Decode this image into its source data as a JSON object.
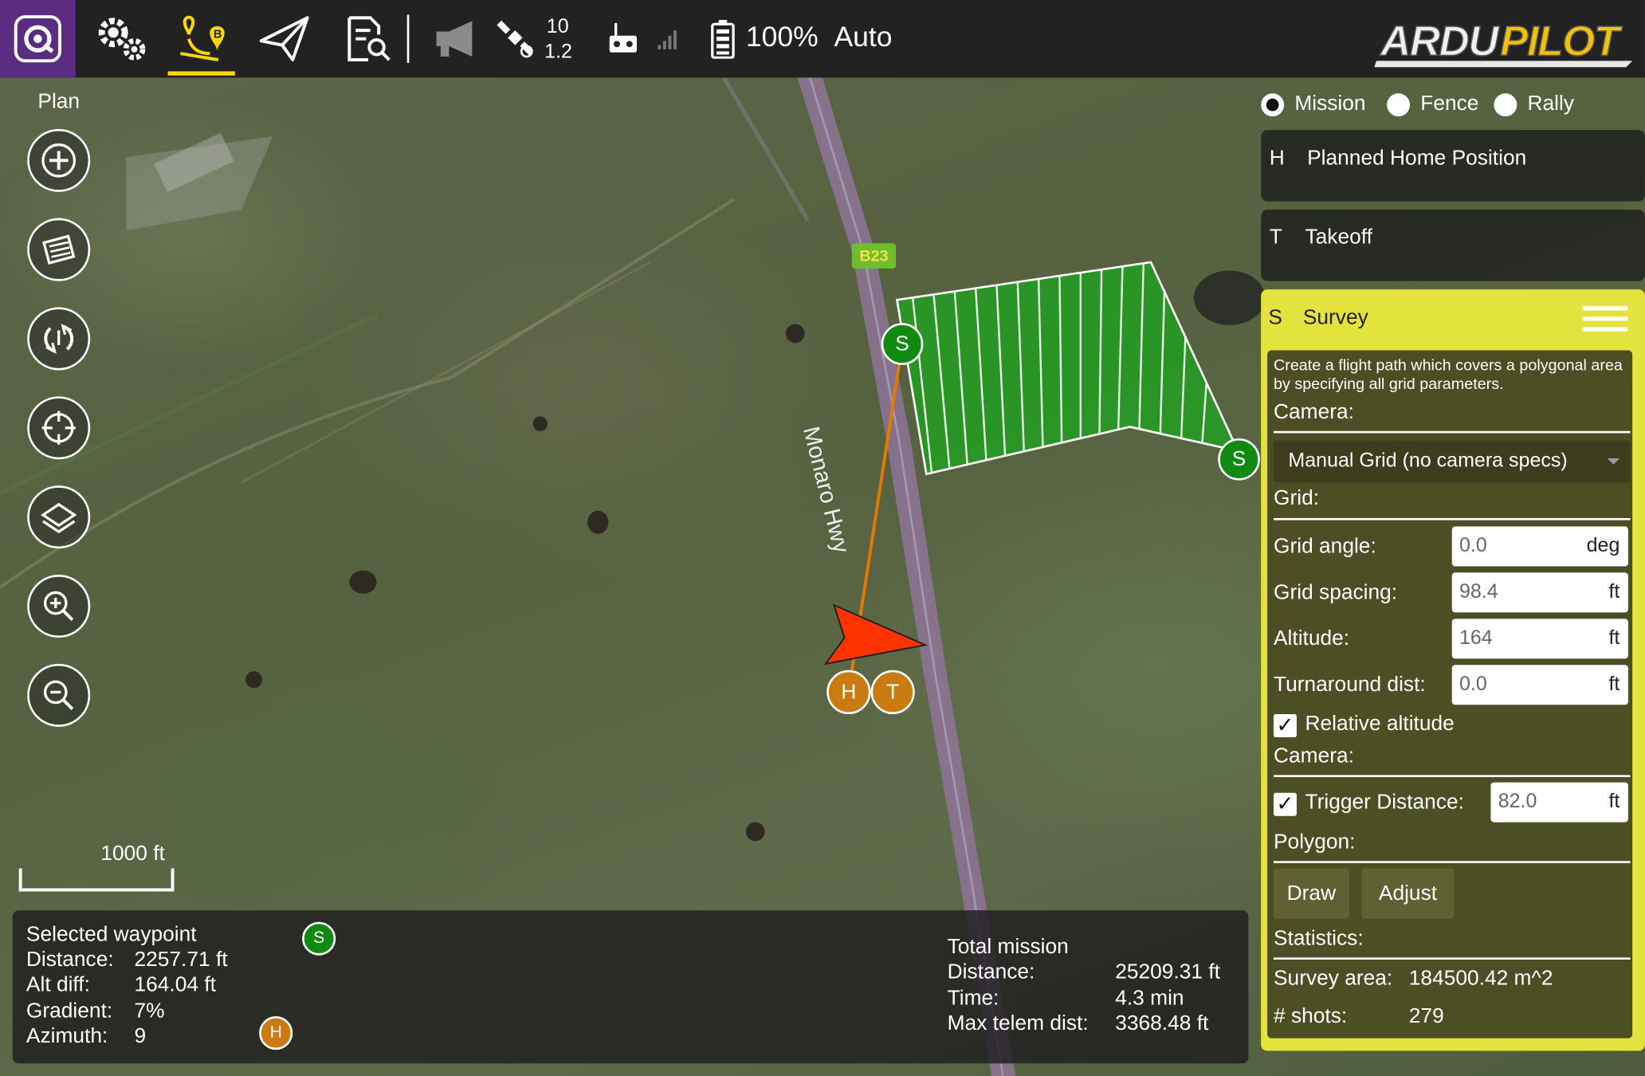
{
  "app": {
    "logo_icon": "qgc-logo-icon"
  },
  "toolbar": {
    "satellite_count": "10",
    "hdop": "1.2",
    "battery": "100%",
    "flight_mode": "Auto",
    "brand": "ARDUPILOT",
    "active_accent": "#ffd700"
  },
  "plan_label": "Plan",
  "plan_types": [
    {
      "label": "Mission",
      "selected": true
    },
    {
      "label": "Fence",
      "selected": false
    },
    {
      "label": "Rally",
      "selected": false
    }
  ],
  "map": {
    "road_label": "Monaro Hwy",
    "road_shield": "B23",
    "scale_text": "1000 ft",
    "markers": {
      "survey": "S",
      "home": "H",
      "takeoff": "T"
    },
    "colors": {
      "survey_fill": "#22a022",
      "path": "#e07b00",
      "vehicle": "#ff3300",
      "road": "#8e7498"
    }
  },
  "mission_items": [
    {
      "letter": "H",
      "title": "Planned Home Position"
    },
    {
      "letter": "T",
      "title": "Takeoff"
    }
  ],
  "survey": {
    "letter": "S",
    "title": "Survey",
    "description": "Create a flight path which covers a polygonal area by specifying all grid parameters.",
    "camera_heading": "Camera:",
    "camera_selection": "Manual Grid (no camera specs)",
    "grid_heading": "Grid:",
    "grid_angle_label": "Grid angle:",
    "grid_angle_value": "0.0",
    "grid_angle_unit": "deg",
    "grid_spacing_label": "Grid spacing:",
    "grid_spacing_value": "98.4",
    "grid_spacing_unit": "ft",
    "altitude_label": "Altitude:",
    "altitude_value": "164",
    "altitude_unit": "ft",
    "turnaround_label": "Turnaround dist:",
    "turnaround_value": "0.0",
    "turnaround_unit": "ft",
    "relative_altitude_label": "Relative altitude",
    "relative_altitude_checked": true,
    "camera_heading_2": "Camera:",
    "trigger_distance_label": "Trigger Distance:",
    "trigger_distance_value": "82.0",
    "trigger_distance_unit": "ft",
    "trigger_checked": true,
    "polygon_heading": "Polygon:",
    "draw_button": "Draw",
    "adjust_button": "Adjust",
    "statistics_heading": "Statistics:",
    "survey_area_label": "Survey area:",
    "survey_area_value": "184500.42 m^2",
    "shots_label": "# shots:",
    "shots_value": "279",
    "accent": "#e4e23d"
  },
  "status": {
    "selected_waypoint": "Selected waypoint",
    "distance_label": "Distance:",
    "distance_value": "2257.71 ft",
    "alt_diff_label": "Alt diff:",
    "alt_diff_value": "164.04 ft",
    "gradient_label": "Gradient:",
    "gradient_value": "7%",
    "azimuth_label": "Azimuth:",
    "azimuth_value": "9",
    "from_marker": "S",
    "to_marker": "H",
    "total_mission": "Total mission",
    "total_distance_label": "Distance:",
    "total_distance_value": "25209.31 ft",
    "time_label": "Time:",
    "time_value": "4.3 min",
    "max_telem_label": "Max telem dist:",
    "max_telem_value": "3368.48 ft"
  }
}
